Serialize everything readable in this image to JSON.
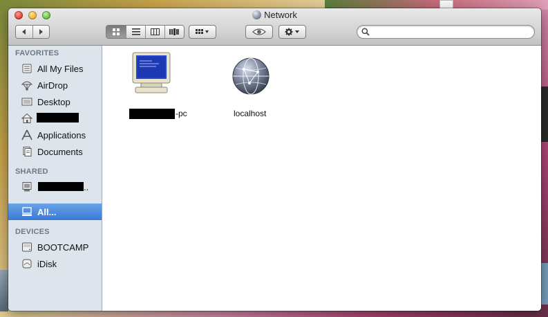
{
  "window": {
    "title": "Network"
  },
  "toolbar": {
    "back_icon": "chevron-left-icon",
    "forward_icon": "chevron-right-icon",
    "view_modes": [
      "icon-view",
      "list-view",
      "column-view",
      "cover-flow-view"
    ],
    "active_view": "icon-view",
    "arrange_icon": "arrange-grid-icon",
    "quicklook_icon": "eye-icon",
    "action_icon": "gear-icon",
    "search_placeholder": ""
  },
  "sidebar": {
    "favorites_header": "FAVORITES",
    "favorites": [
      {
        "label": "All My Files",
        "icon": "all-files-icon"
      },
      {
        "label": "AirDrop",
        "icon": "airdrop-icon"
      },
      {
        "label": "Desktop",
        "icon": "desktop-icon"
      },
      {
        "label": "",
        "icon": "home-icon"
      },
      {
        "label": "Applications",
        "icon": "applications-icon"
      },
      {
        "label": "Documents",
        "icon": "documents-icon"
      }
    ],
    "shared_header": "SHARED",
    "shared": [
      {
        "label": "..",
        "icon": "computer-icon"
      },
      {
        "label": "All...",
        "icon": "network-icon",
        "selected": true
      }
    ],
    "devices_header": "DEVICES",
    "devices": [
      {
        "label": "BOOTCAMP",
        "icon": "disk-icon"
      },
      {
        "label": "iDisk",
        "icon": "idisk-icon"
      }
    ]
  },
  "content": {
    "items": [
      {
        "label": "-pc",
        "icon": "pc-monitor-icon"
      },
      {
        "label": "localhost",
        "icon": "network-globe-icon"
      }
    ]
  },
  "colors": {
    "selection": "#3a7ad6",
    "sidebar_bg": "#dde4ec",
    "section_header": "#6d7683"
  }
}
